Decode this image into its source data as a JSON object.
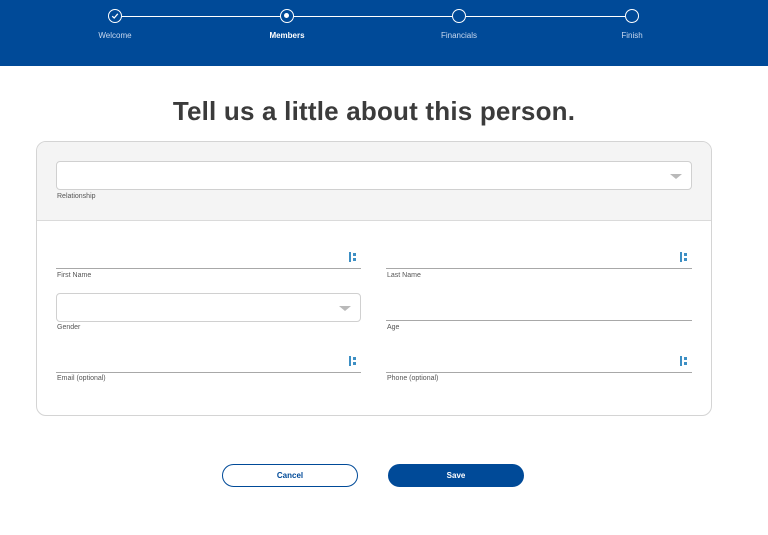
{
  "stepper": {
    "steps": [
      {
        "label": "Welcome",
        "state": "completed"
      },
      {
        "label": "Members",
        "state": "current"
      },
      {
        "label": "Financials",
        "state": "upcoming"
      },
      {
        "label": "Finish",
        "state": "upcoming"
      }
    ]
  },
  "page": {
    "title": "Tell us a little about this person."
  },
  "form": {
    "relationship": {
      "label": "Relationship",
      "value": ""
    },
    "first_name": {
      "label": "First Name",
      "value": ""
    },
    "last_name": {
      "label": "Last Name",
      "value": ""
    },
    "gender": {
      "label": "Gender",
      "value": ""
    },
    "age": {
      "label": "Age",
      "value": ""
    },
    "email": {
      "label": "Email (optional)",
      "value": ""
    },
    "phone": {
      "label": "Phone (optional)",
      "value": ""
    }
  },
  "actions": {
    "cancel_label": "Cancel",
    "save_label": "Save"
  },
  "colors": {
    "brand": "#004a98",
    "icon_accent": "#3d8fc4"
  },
  "icons": {
    "completed_step": "check-icon",
    "field_icon": "keyboard-hint-icon",
    "dropdown": "caret-down-icon"
  }
}
